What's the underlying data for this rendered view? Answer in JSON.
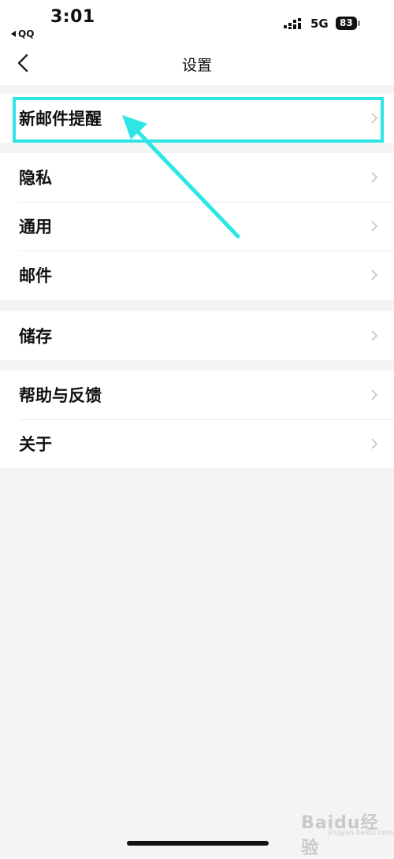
{
  "status_bar": {
    "time": "3:01",
    "back_app": "QQ",
    "network": "5G",
    "battery": "83"
  },
  "nav": {
    "title": "设置",
    "back_icon": "chevron-left-icon"
  },
  "groups": [
    {
      "items": [
        {
          "label": "新邮件提醒"
        }
      ]
    },
    {
      "items": [
        {
          "label": "隐私"
        },
        {
          "label": "通用"
        },
        {
          "label": "邮件"
        }
      ]
    },
    {
      "items": [
        {
          "label": "储存"
        }
      ]
    },
    {
      "items": [
        {
          "label": "帮助与反馈"
        },
        {
          "label": "关于"
        }
      ]
    }
  ],
  "annotation": {
    "highlight_color": "#2ee6e6"
  },
  "watermark": {
    "brand": "Baidu经验",
    "url": "jingyan.baidu.com"
  }
}
